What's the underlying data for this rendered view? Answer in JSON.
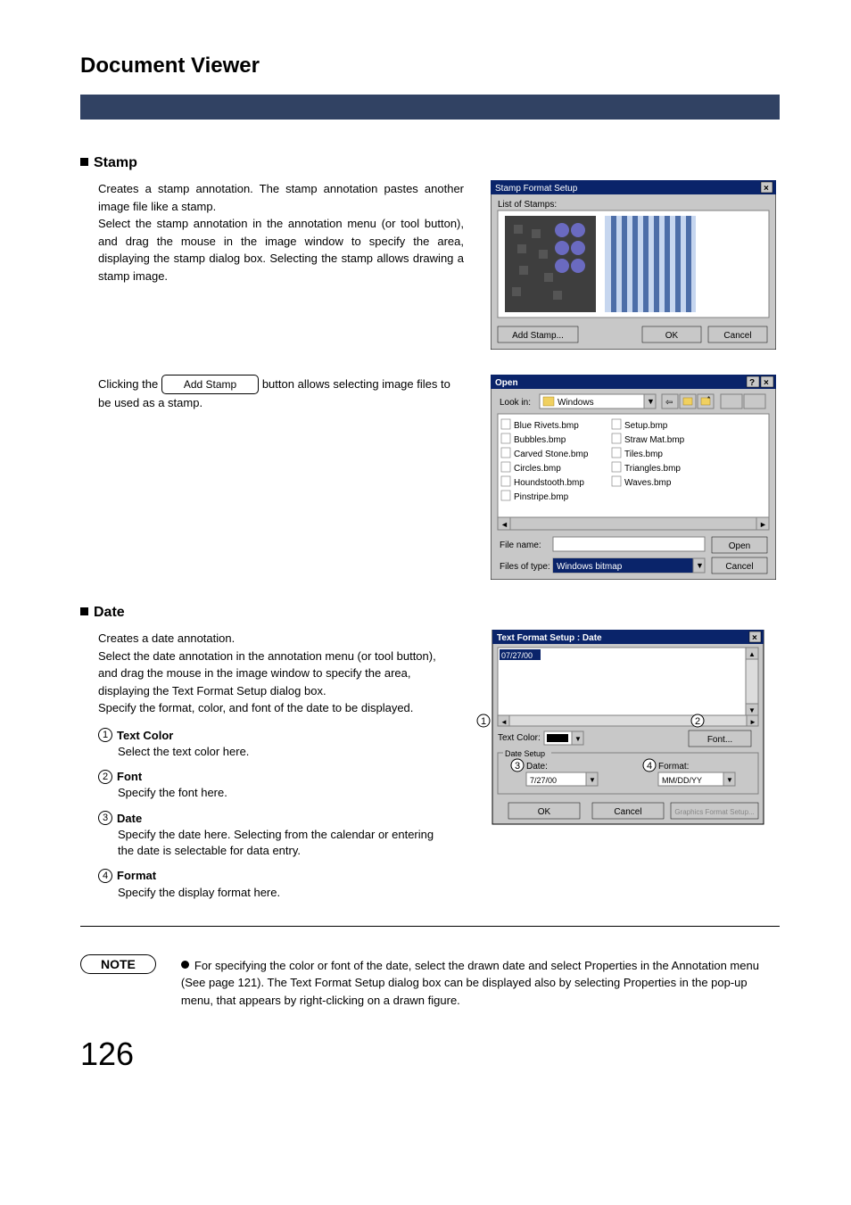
{
  "app_title": "Document Viewer",
  "stamp": {
    "heading": "Stamp",
    "para1": "Creates a stamp annotation. The stamp annotation pastes another image file like a stamp.",
    "para2": "Select the stamp annotation in the annotation menu (or tool button), and drag the mouse in the image window to specify the area, displaying the stamp dialog box. Selecting the stamp allows drawing a stamp image.",
    "click_prefix": "Clicking the",
    "click_btn": "Add Stamp",
    "click_suffix": "button allows selecting image files to be used as a stamp.",
    "dialog": {
      "title": "Stamp Format Setup",
      "label": "List of Stamps:",
      "add": "Add Stamp...",
      "ok": "OK",
      "cancel": "Cancel"
    },
    "open_dialog": {
      "title": "Open",
      "lookin_label": "Look in:",
      "lookin_value": "Windows",
      "files_left": [
        "Blue Rivets.bmp",
        "Bubbles.bmp",
        "Carved Stone.bmp",
        "Circles.bmp",
        "Houndstooth.bmp",
        "Pinstripe.bmp"
      ],
      "files_right": [
        "Setup.bmp",
        "Straw Mat.bmp",
        "Tiles.bmp",
        "Triangles.bmp",
        "Waves.bmp"
      ],
      "filename_label": "File name:",
      "filetype_label": "Files of type:",
      "filetype_value": "Windows bitmap",
      "open_btn": "Open",
      "cancel_btn": "Cancel"
    }
  },
  "date": {
    "heading": "Date",
    "para1": "Creates a date annotation.",
    "para2": "Select the date annotation in the annotation menu (or tool button), and drag the mouse in the image window to specify the area, displaying the Text Format Setup dialog box.",
    "para3": "Specify the format, color, and font of the date to be displayed.",
    "props": [
      {
        "n": "1",
        "label": "Text Color",
        "desc": "Select the text color here."
      },
      {
        "n": "2",
        "label": "Font",
        "desc": "Specify the font here."
      },
      {
        "n": "3",
        "label": "Date",
        "desc": "Specify the date here. Selecting from the calendar or entering the date is selectable for data entry."
      },
      {
        "n": "4",
        "label": "Format",
        "desc": "Specify the display format here."
      }
    ],
    "dialog": {
      "title": "Text Format Setup : Date",
      "sample": "07/27/00",
      "textcolor_label": "Text Color:",
      "font_btn": "Font...",
      "group": "Date Setup",
      "date_label": "Date:",
      "date_value": "7/27/00",
      "format_label": "Format:",
      "format_value": "MM/DD/YY",
      "ok": "OK",
      "cancel": "Cancel",
      "graphic": "Graphics Format Setup..."
    }
  },
  "note": {
    "label": "NOTE",
    "text": "For specifying the color or font of the date, select the drawn date and select Properties in the Annotation menu (See page 121). The Text Format Setup dialog box can be displayed also by selecting Properties in the pop-up menu, that appears by right-clicking on a drawn figure."
  },
  "page_number": "126"
}
